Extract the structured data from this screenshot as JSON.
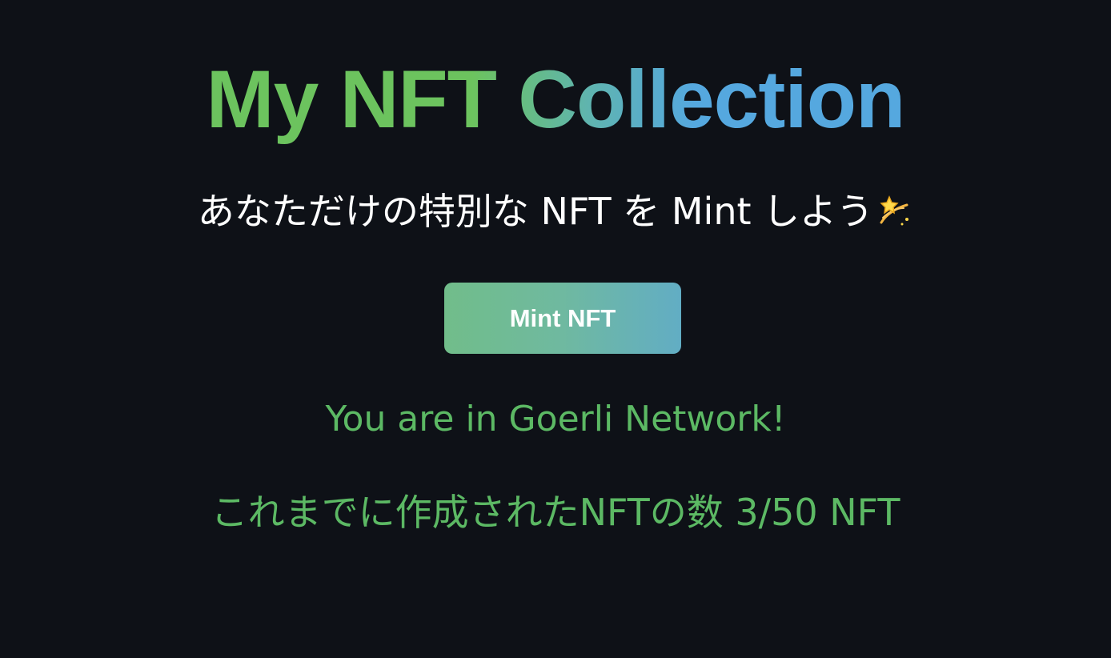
{
  "header": {
    "title": "My NFT Collection",
    "subtitle": "あなただけの特別な NFT を Mint しよう",
    "subtitle_icon": "sparkle-icon"
  },
  "mint_button": {
    "label": "Mint NFT"
  },
  "status": {
    "network": "You are in Goerli Network!",
    "minted_count": "これまでに作成されたNFTの数 3/50 NFT"
  },
  "colors": {
    "background": "#0e1117",
    "title_gradient_start": "#6cc35e",
    "title_gradient_end": "#55a8df",
    "button_gradient_start": "#71bd8a",
    "button_gradient_end": "#62adc4",
    "status_text": "#5cb964"
  }
}
